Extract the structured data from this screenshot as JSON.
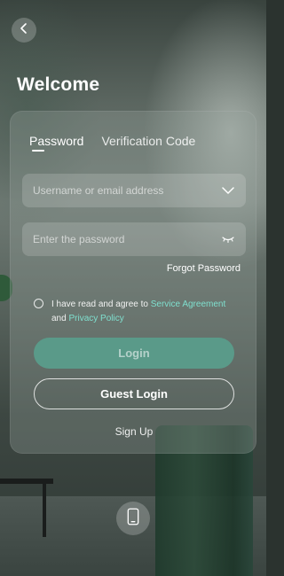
{
  "header": {
    "title": "Welcome"
  },
  "tabs": [
    {
      "label": "Password",
      "active": true
    },
    {
      "label": "Verification Code",
      "active": false
    }
  ],
  "form": {
    "username_placeholder": "Username or email address",
    "password_placeholder": "Enter the password",
    "forgot_label": "Forgot Password"
  },
  "agreement": {
    "prefix": "I have read and agree to ",
    "service_link": "Service Agreement",
    "middle": "and ",
    "privacy_link": "Privacy Policy",
    "checked": false
  },
  "buttons": {
    "login": "Login",
    "guest_login": "Guest Login",
    "sign_up": "Sign Up"
  },
  "icons": {
    "back": "chevron-left-icon",
    "dropdown": "chevron-down-icon",
    "password_visibility": "eye-closed-icon",
    "phone": "phone-icon"
  },
  "colors": {
    "accent": "#7fe0cf",
    "login_button": "#5a9a89"
  }
}
